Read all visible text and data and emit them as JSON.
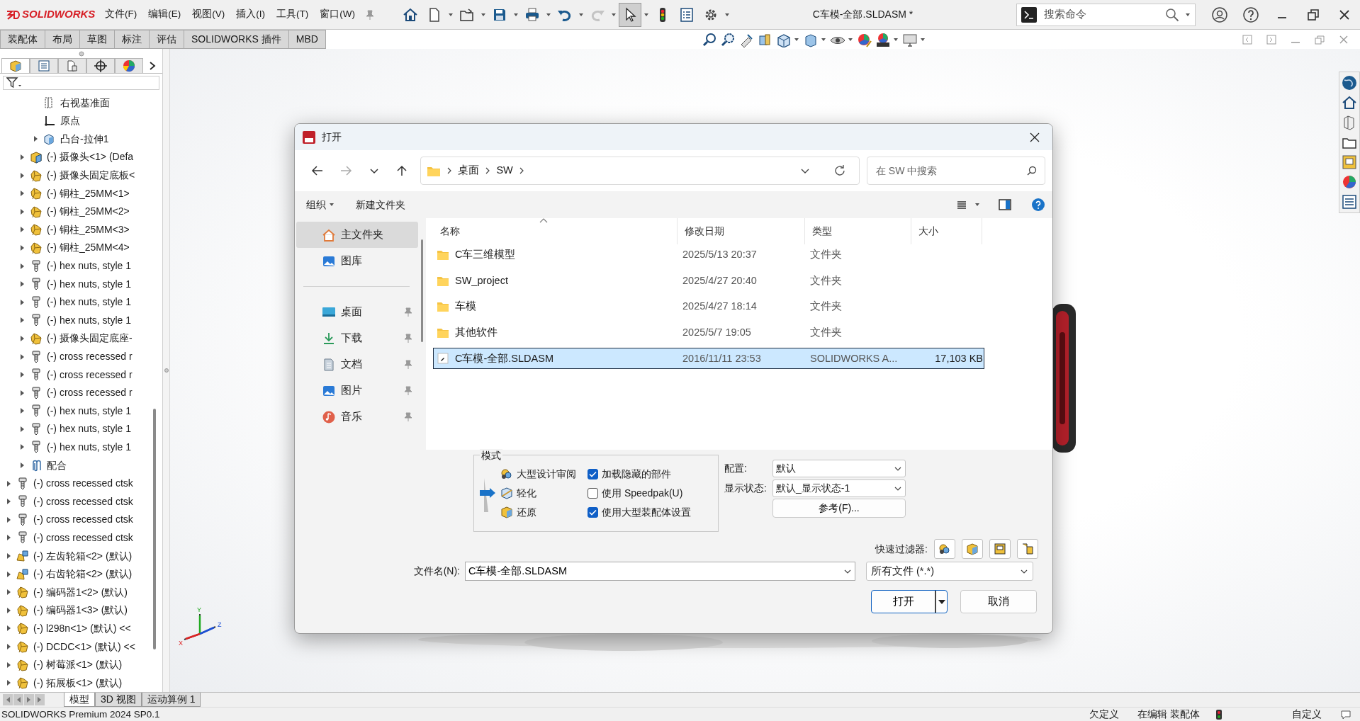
{
  "app": {
    "logo": "SOLIDWORKS",
    "menus": [
      "文件(F)",
      "编辑(E)",
      "视图(V)",
      "插入(I)",
      "工具(T)",
      "窗口(W)"
    ],
    "title": "C车模-全部.SLDASM *",
    "search": {
      "placeholder": "搜索命令"
    },
    "select_tool_selected": true
  },
  "command_tabs": [
    {
      "label": "装配体",
      "selected": false
    },
    {
      "label": "布局",
      "selected": false
    },
    {
      "label": "草图",
      "selected": false
    },
    {
      "label": "标注",
      "selected": false
    },
    {
      "label": "评估",
      "selected": false
    },
    {
      "label": "SOLIDWORKS 插件",
      "selected": false
    },
    {
      "label": "MBD",
      "selected": false
    }
  ],
  "feature_tree": {
    "panel_tabs": [
      {
        "kind": "features",
        "selected": true
      },
      {
        "kind": "properties",
        "selected": false
      },
      {
        "kind": "configurations",
        "selected": false
      },
      {
        "kind": "dimxpert",
        "selected": false
      },
      {
        "kind": "display",
        "selected": false
      }
    ],
    "items": [
      {
        "children": [
          {
            "children": [
              {
                "label": "右视基准面",
                "kind": "plane"
              },
              {
                "label": "原点",
                "kind": "origin"
              },
              {
                "label": "凸台-拉伸1",
                "kind": "feature",
                "expanded": false
              }
            ]
          },
          {
            "label": "(-) 摄像头<1> (Defa",
            "kind": "body",
            "expanded": false
          },
          {
            "label": "(-) 摄像头固定底板<",
            "kind": "part",
            "expanded": false
          },
          {
            "label": "(-) 铜柱_25MM<1>",
            "kind": "part",
            "expanded": false
          },
          {
            "label": "(-) 铜柱_25MM<2>",
            "kind": "part",
            "expanded": false
          },
          {
            "label": "(-) 铜柱_25MM<3>",
            "kind": "part",
            "expanded": false
          },
          {
            "label": "(-) 铜柱_25MM<4>",
            "kind": "part",
            "expanded": false
          },
          {
            "label": "(-) hex nuts, style 1",
            "kind": "fastener",
            "expanded": false
          },
          {
            "label": "(-) hex nuts, style 1",
            "kind": "fastener",
            "expanded": false
          },
          {
            "label": "(-) hex nuts, style 1",
            "kind": "fastener",
            "expanded": false
          },
          {
            "label": "(-) hex nuts, style 1",
            "kind": "fastener",
            "expanded": false
          },
          {
            "label": "(-) 摄像头固定底座-",
            "kind": "part",
            "expanded": false
          },
          {
            "label": "(-) cross recessed r",
            "kind": "fastener",
            "expanded": false
          },
          {
            "label": "(-) cross recessed r",
            "kind": "fastener",
            "expanded": false
          },
          {
            "label": "(-) cross recessed r",
            "kind": "fastener",
            "expanded": false
          },
          {
            "label": "(-) hex nuts, style 1",
            "kind": "fastener",
            "expanded": false
          },
          {
            "label": "(-) hex nuts, style 1",
            "kind": "fastener",
            "expanded": false
          },
          {
            "label": "(-) hex nuts, style 1",
            "kind": "fastener",
            "expanded": false
          },
          {
            "label": "配合",
            "kind": "mates",
            "expanded": false
          }
        ]
      },
      {
        "label": "(-) cross recessed ctsk",
        "kind": "fastener",
        "expanded": false
      },
      {
        "label": "(-) cross recessed ctsk",
        "kind": "fastener",
        "expanded": false
      },
      {
        "label": "(-) cross recessed ctsk",
        "kind": "fastener",
        "expanded": false
      },
      {
        "label": "(-) cross recessed ctsk",
        "kind": "fastener",
        "expanded": false
      },
      {
        "label": "(-) 左齿轮箱<2> (默认)",
        "kind": "subassembly",
        "expanded": false
      },
      {
        "label": "(-) 右齿轮箱<2> (默认)",
        "kind": "subassembly",
        "expanded": false
      },
      {
        "label": "(-) 编码器1<2> (默认)",
        "kind": "part",
        "expanded": false
      },
      {
        "label": "(-) 编码器1<3> (默认)",
        "kind": "part",
        "expanded": false
      },
      {
        "label": "(-) l298n<1> (默认) <<",
        "kind": "part",
        "expanded": false
      },
      {
        "label": "(-) DCDC<1> (默认) <<",
        "kind": "part",
        "expanded": false
      },
      {
        "label": "(-) 树莓派<1> (默认)",
        "kind": "part",
        "expanded": false
      },
      {
        "label": "(-) 拓展板<1> (默认)",
        "kind": "part",
        "expanded": false
      }
    ]
  },
  "triad": {
    "x": "X",
    "y": "Y",
    "z": "Z"
  },
  "dialog": {
    "title": "打开",
    "breadcrumb": [
      "桌面",
      "SW"
    ],
    "search": {
      "placeholder": "在 SW 中搜索"
    },
    "commands": {
      "organize": "组织",
      "new_folder": "新建文件夹"
    },
    "nav_pane": [
      [
        {
          "label": "主文件夹",
          "kind": "home",
          "pinned": false,
          "selected": true
        },
        {
          "label": "图库",
          "kind": "gallery",
          "pinned": false,
          "selected": false
        }
      ],
      [
        {
          "label": "桌面",
          "kind": "desktop",
          "pinned": true,
          "selected": false
        },
        {
          "label": "下载",
          "kind": "downloads",
          "pinned": true,
          "selected": false
        },
        {
          "label": "文档",
          "kind": "documents",
          "pinned": true,
          "selected": false
        },
        {
          "label": "图片",
          "kind": "pictures",
          "pinned": true,
          "selected": false
        },
        {
          "label": "音乐",
          "kind": "music",
          "pinned": true,
          "selected": false
        }
      ]
    ],
    "columns": [
      "名称",
      "修改日期",
      "类型",
      "大小"
    ],
    "files": [
      {
        "name": "C车三维模型",
        "date": "2025/5/13 20:37",
        "type": "文件夹",
        "kind": "folder",
        "selected": false
      },
      {
        "name": "SW_project",
        "date": "2025/4/27 20:40",
        "type": "文件夹",
        "kind": "folder",
        "selected": false
      },
      {
        "name": "车模",
        "date": "2025/4/27 18:14",
        "type": "文件夹",
        "kind": "folder",
        "selected": false
      },
      {
        "name": "其他软件",
        "date": "2025/5/7 19:05",
        "type": "文件夹",
        "kind": "folder",
        "selected": false
      },
      {
        "name": "C车模-全部.SLDASM",
        "date": "2016/11/11 23:53",
        "type": "SOLIDWORKS A...",
        "size": "17,103 KB",
        "kind": "file",
        "selected": true
      }
    ],
    "mode": {
      "legend": "模式",
      "options": [
        {
          "label": "大型设计审阅",
          "selected": false
        },
        {
          "label": "轻化",
          "selected": true
        },
        {
          "label": "还原",
          "selected": false
        }
      ],
      "checkboxes": [
        {
          "label": "加载隐藏的部件",
          "checked": true
        },
        {
          "label": "使用 Speedpak(U)",
          "checked": false
        },
        {
          "label": "使用大型装配体设置",
          "checked": true
        }
      ]
    },
    "configuration": {
      "label": "配置:",
      "value": "默认"
    },
    "display_state": {
      "label": "显示状态:",
      "value": "默认_显示状态-1"
    },
    "references_button": "参考(F)...",
    "quick_filter_label": "快速过滤器:",
    "file_name": {
      "label": "文件名(N):",
      "value": "C车模-全部.SLDASM"
    },
    "file_type": "所有文件 (*.*)",
    "open_button": "打开",
    "cancel_button": "取消"
  },
  "bottom_tabs": [
    {
      "label": "模型",
      "selected": true
    },
    {
      "label": "3D 视图",
      "selected": false
    },
    {
      "label": "运动算例 1",
      "selected": false
    }
  ],
  "status_bar": {
    "product": "SOLIDWORKS Premium 2024 SP0.1",
    "state": "欠定义",
    "editing": "在编辑 装配体",
    "units": "自定义"
  }
}
